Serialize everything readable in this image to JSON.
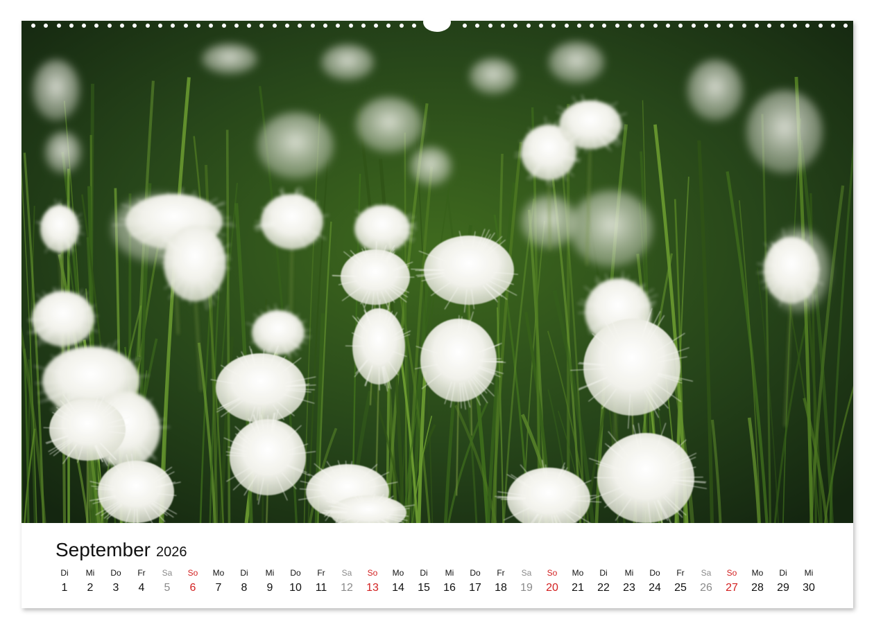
{
  "photo": {
    "subject": "cotton-grass-photo",
    "colors": {
      "background_dark": "#1c3312",
      "grass_green": "#4f7a22",
      "cotton_white": "#f4f4ef"
    }
  },
  "calendar": {
    "month": "September",
    "year": "2026",
    "days": [
      {
        "wd": "Di",
        "n": "1",
        "type": "weekday"
      },
      {
        "wd": "Mi",
        "n": "2",
        "type": "weekday"
      },
      {
        "wd": "Do",
        "n": "3",
        "type": "weekday"
      },
      {
        "wd": "Fr",
        "n": "4",
        "type": "weekday"
      },
      {
        "wd": "Sa",
        "n": "5",
        "type": "sat"
      },
      {
        "wd": "So",
        "n": "6",
        "type": "sun"
      },
      {
        "wd": "Mo",
        "n": "7",
        "type": "weekday"
      },
      {
        "wd": "Di",
        "n": "8",
        "type": "weekday"
      },
      {
        "wd": "Mi",
        "n": "9",
        "type": "weekday"
      },
      {
        "wd": "Do",
        "n": "10",
        "type": "weekday"
      },
      {
        "wd": "Fr",
        "n": "11",
        "type": "weekday"
      },
      {
        "wd": "Sa",
        "n": "12",
        "type": "sat"
      },
      {
        "wd": "So",
        "n": "13",
        "type": "sun"
      },
      {
        "wd": "Mo",
        "n": "14",
        "type": "weekday"
      },
      {
        "wd": "Di",
        "n": "15",
        "type": "weekday"
      },
      {
        "wd": "Mi",
        "n": "16",
        "type": "weekday"
      },
      {
        "wd": "Do",
        "n": "17",
        "type": "weekday"
      },
      {
        "wd": "Fr",
        "n": "18",
        "type": "weekday"
      },
      {
        "wd": "Sa",
        "n": "19",
        "type": "sat"
      },
      {
        "wd": "So",
        "n": "20",
        "type": "sun"
      },
      {
        "wd": "Mo",
        "n": "21",
        "type": "weekday"
      },
      {
        "wd": "Di",
        "n": "22",
        "type": "weekday"
      },
      {
        "wd": "Mi",
        "n": "23",
        "type": "weekday"
      },
      {
        "wd": "Do",
        "n": "24",
        "type": "weekday"
      },
      {
        "wd": "Fr",
        "n": "25",
        "type": "weekday"
      },
      {
        "wd": "Sa",
        "n": "26",
        "type": "sat"
      },
      {
        "wd": "So",
        "n": "27",
        "type": "sun"
      },
      {
        "wd": "Mo",
        "n": "28",
        "type": "weekday"
      },
      {
        "wd": "Di",
        "n": "29",
        "type": "weekday"
      },
      {
        "wd": "Mi",
        "n": "30",
        "type": "weekday"
      }
    ],
    "colors": {
      "weekday": "#111111",
      "saturday": "#8a8a8a",
      "sunday": "#d21f1f"
    }
  }
}
